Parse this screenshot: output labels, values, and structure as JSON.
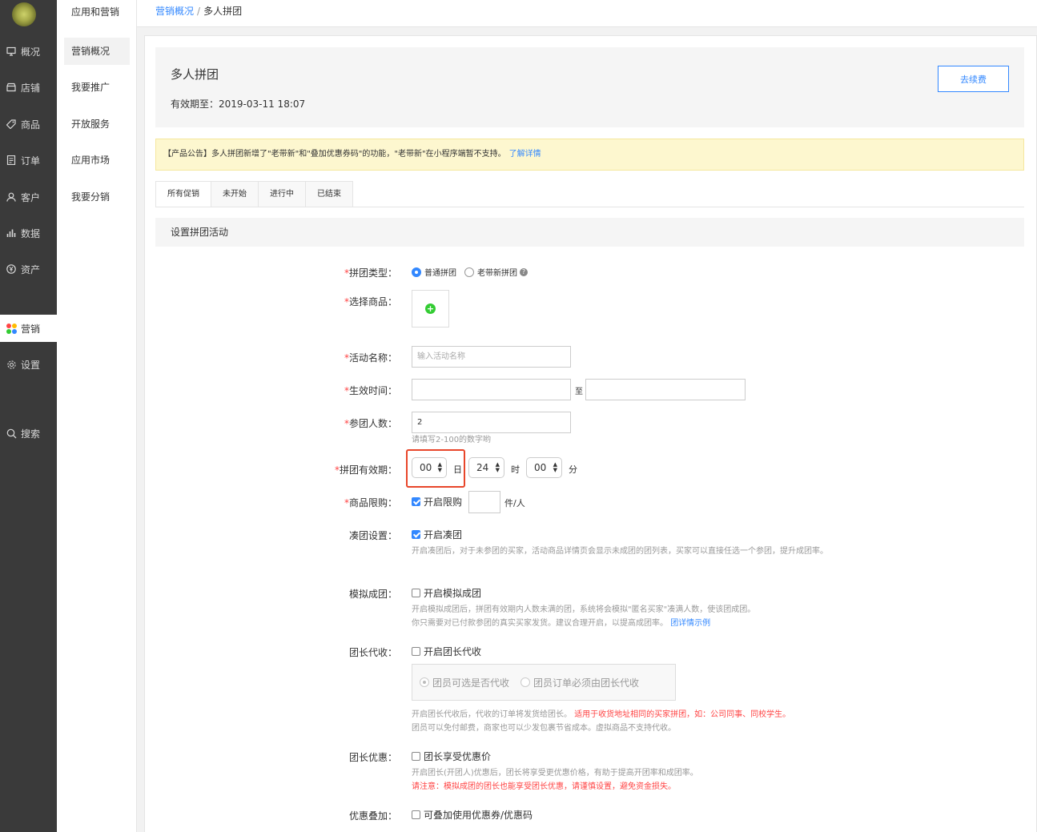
{
  "sidebar": {
    "items": [
      {
        "icon": "monitor-icon",
        "label": "概况"
      },
      {
        "icon": "store-icon",
        "label": "店铺"
      },
      {
        "icon": "tag-icon",
        "label": "商品"
      },
      {
        "icon": "order-list-icon",
        "label": "订单"
      },
      {
        "icon": "user-icon",
        "label": "客户"
      },
      {
        "icon": "bar-chart-icon",
        "label": "数据"
      },
      {
        "icon": "yen-coin-icon",
        "label": "资产"
      },
      {
        "icon": "apps-dots-icon",
        "label": "营销"
      },
      {
        "icon": "gear-icon",
        "label": "设置"
      },
      {
        "icon": "search-icon",
        "label": "搜索"
      }
    ]
  },
  "subnav": {
    "title": "应用和营销",
    "items": [
      "营销概况",
      "我要推广",
      "开放服务",
      "应用市场",
      "我要分销"
    ]
  },
  "breadcrumb": {
    "link": "营销概况",
    "separator": "/",
    "current": "多人拼团"
  },
  "header": {
    "title": "多人拼团",
    "validity": "有效期至：2019-03-11 18:07",
    "renew_label": "去续费"
  },
  "notice": {
    "text": "【产品公告】多人拼团新增了\"老带新\"和\"叠加优惠券码\"的功能，\"老带新\"在小程序端暂不支持。",
    "link": "了解详情"
  },
  "tabs": [
    "所有促销",
    "未开始",
    "进行中",
    "已结束"
  ],
  "section_title": "设置拼团活动",
  "form": {
    "group_type": {
      "label": "拼团类型：",
      "options": [
        "普通拼团",
        "老带新拼团"
      ],
      "selected": "普通拼团"
    },
    "product": {
      "label": "选择商品："
    },
    "name": {
      "label": "活动名称：",
      "placeholder": "输入活动名称"
    },
    "time": {
      "label": "生效时间：",
      "to": "至"
    },
    "people": {
      "label": "参团人数：",
      "value": "2",
      "hint": "请填写2-100的数字哟"
    },
    "validity": {
      "label": "拼团有效期：",
      "day": "00",
      "day_unit": "日",
      "hour": "24",
      "hour_unit": "时",
      "minute": "00",
      "minute_unit": "分"
    },
    "limit": {
      "label": "商品限购：",
      "check_label": "开启限购",
      "checked": true,
      "unit": "件/人"
    },
    "makeup": {
      "label": "凑团设置：",
      "check_label": "开启凑团",
      "checked": true,
      "hint": "开启凑团后，对于未参团的买家，活动商品详情页会显示未成团的团列表，买家可以直接任选一个参团，提升成团率。"
    },
    "simulate": {
      "label": "模拟成团：",
      "check_label": "开启模拟成团",
      "checked": false,
      "hint1": "开启模拟成团后，拼团有效期内人数未满的团，系统将会模拟\"匿名买家\"凑满人数，使该团成团。",
      "hint2": "你只需要对已付款参团的真实买家发货。建议合理开启，以提高成团率。",
      "hint_link": "团详情示例"
    },
    "leader_collect": {
      "label": "团长代收：",
      "check_label": "开启团长代收",
      "checked": false,
      "options": [
        "团员可选是否代收",
        "团员订单必须由团长代收"
      ],
      "hint1": "开启团长代收后，代收的订单将发货给团长。",
      "hint1_red": "适用于收货地址相同的买家拼团，如：公司同事、同校学生。",
      "hint2": "团员可以免付邮费，商家也可以少发包裹节省成本。虚拟商品不支持代收。"
    },
    "leader_discount": {
      "label": "团长优惠：",
      "check_label": "团长享受优惠价",
      "checked": false,
      "hint1": "开启团长(开团人)优惠后，团长将享受更优惠价格，有助于提高开团率和成团率。",
      "hint2_red": "请注意：模拟成团的团长也能享受团长优惠，请谨慎设置，避免资金损失。"
    },
    "stack": {
      "label": "优惠叠加：",
      "check_label": "可叠加使用优惠券/优惠码",
      "checked": false
    }
  },
  "colors": {
    "accent": "#3388ff",
    "required": "#ff4444",
    "highlight_frame": "#e8462a",
    "sidebar_bg": "#3a3a3a"
  }
}
